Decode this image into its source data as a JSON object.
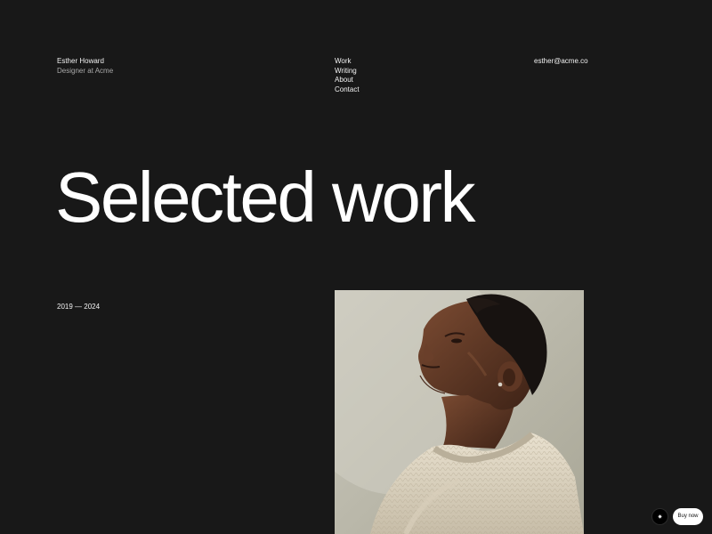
{
  "header": {
    "name": "Esther Howard",
    "role": "Designer at Acme",
    "nav": [
      "Work",
      "Writing",
      "About",
      "Contact"
    ],
    "email": "esther@acme.co"
  },
  "hero": {
    "title": "Selected work",
    "years": "2019 — 2024"
  },
  "floating": {
    "badge_icon": "star-icon",
    "badge_symbol": "✷",
    "buy_label": "Buy now"
  },
  "colors": {
    "background": "#181818",
    "text": "#f2f2f2",
    "photo_background": "#c4c2b4"
  }
}
